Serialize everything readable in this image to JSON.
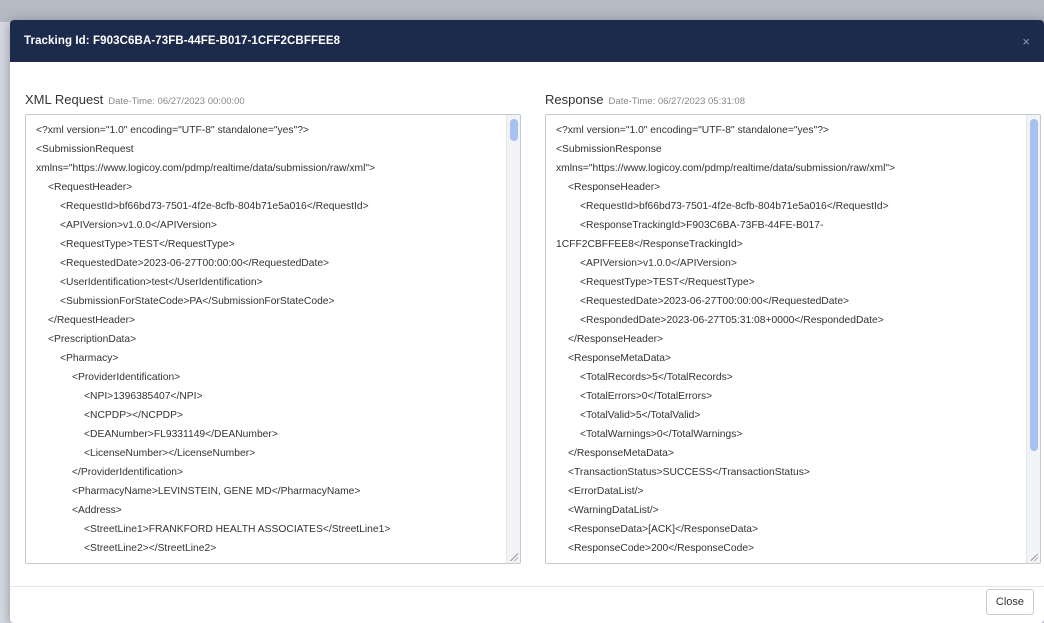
{
  "modal": {
    "title": "Tracking Id: F903C6BA-73FB-44FE-B017-1CFF2CBFFEE8",
    "close_icon": "×",
    "close_button_label": "Close"
  },
  "request": {
    "title": "XML Request",
    "datetime": "Date-Time: 06/27/2023 00:00:00",
    "lines": [
      "<?xml version=\"1.0\" encoding=\"UTF-8\" standalone=\"yes\"?>",
      "<SubmissionRequest",
      "xmlns=\"https://www.logicoy.com/pdmp/realtime/data/submission/raw/xml\">",
      "  <RequestHeader>",
      "    <RequestId>bf66bd73-7501-4f2e-8cfb-804b71e5a016</RequestId>",
      "    <APIVersion>v1.0.0</APIVersion>",
      "    <RequestType>TEST</RequestType>",
      "    <RequestedDate>2023-06-27T00:00:00</RequestedDate>",
      "    <UserIdentification>test</UserIdentification>",
      "    <SubmissionForStateCode>PA</SubmissionForStateCode>",
      "  </RequestHeader>",
      "  <PrescriptionData>",
      "    <Pharmacy>",
      "      <ProviderIdentification>",
      "        <NPI>1396385407</NPI>",
      "        <NCPDP></NCPDP>",
      "        <DEANumber>FL9331149</DEANumber>",
      "        <LicenseNumber></LicenseNumber>",
      "      </ProviderIdentification>",
      "      <PharmacyName>LEVINSTEIN, GENE MD</PharmacyName>",
      "      <Address>",
      "        <StreetLine1>FRANKFORD HEALTH ASSOCIATES</StreetLine1>",
      "        <StreetLine2></StreetLine2>"
    ]
  },
  "response": {
    "title": "Response",
    "datetime": "Date-Time: 06/27/2023 05:31:08",
    "lines": [
      "<?xml version=\"1.0\" encoding=\"UTF-8\" standalone=\"yes\"?>",
      "<SubmissionResponse",
      "xmlns=\"https://www.logicoy.com/pdmp/realtime/data/submission/raw/xml\">",
      "  <ResponseHeader>",
      "    <RequestId>bf66bd73-7501-4f2e-8cfb-804b71e5a016</RequestId>",
      "    <ResponseTrackingId>F903C6BA-73FB-44FE-B017-",
      "1CFF2CBFFEE8</ResponseTrackingId>",
      "    <APIVersion>v1.0.0</APIVersion>",
      "    <RequestType>TEST</RequestType>",
      "    <RequestedDate>2023-06-27T00:00:00</RequestedDate>",
      "    <RespondedDate>2023-06-27T05:31:08+0000</RespondedDate>",
      "  </ResponseHeader>",
      "  <ResponseMetaData>",
      "    <TotalRecords>5</TotalRecords>",
      "    <TotalErrors>0</TotalErrors>",
      "    <TotalValid>5</TotalValid>",
      "    <TotalWarnings>0</TotalWarnings>",
      "  </ResponseMetaData>",
      "  <TransactionStatus>SUCCESS</TransactionStatus>",
      "  <ErrorDataList/>",
      "  <WarningDataList/>",
      "  <ResponseData>[ACK]</ResponseData>",
      "  <ResponseCode>200</ResponseCode>"
    ]
  }
}
